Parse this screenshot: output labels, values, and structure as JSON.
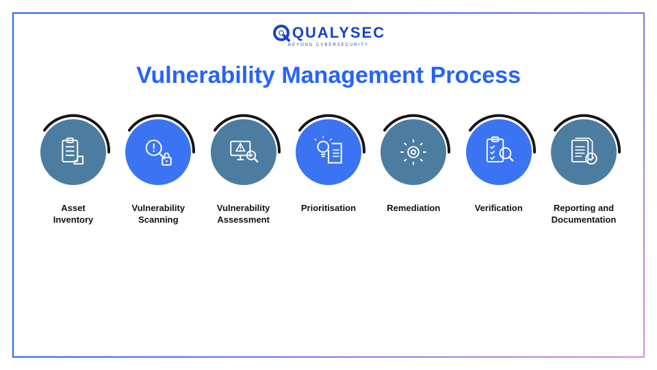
{
  "brand": {
    "name": "QUALYSEC",
    "tagline": "BEYOND CYBERSECURITY"
  },
  "title": "Vulnerability Management Process",
  "steps": [
    {
      "label": "Asset\nInventory",
      "icon": "clipboard-box-icon",
      "tone": "muted"
    },
    {
      "label": "Vulnerability\nScanning",
      "icon": "scan-lock-icon",
      "tone": "bright"
    },
    {
      "label": "Vulnerability\nAssessment",
      "icon": "monitor-alert-icon",
      "tone": "muted"
    },
    {
      "label": "Prioritisation",
      "icon": "idea-doc-icon",
      "tone": "bright"
    },
    {
      "label": "Remediation",
      "icon": "gear-icon",
      "tone": "muted"
    },
    {
      "label": "Verification",
      "icon": "checklist-lens-icon",
      "tone": "bright"
    },
    {
      "label": "Reporting and\nDocumentation",
      "icon": "report-check-icon",
      "tone": "muted"
    }
  ]
}
